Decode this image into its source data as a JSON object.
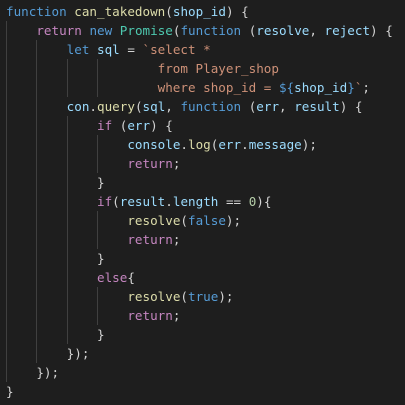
{
  "editor": {
    "colors": {
      "background": "#1e1e1e",
      "keyword": "#569cd6",
      "control": "#c586c0",
      "function": "#dcdcaa",
      "variable": "#9cdcfe",
      "string": "#ce9178",
      "class": "#4ec9b0",
      "number": "#b5cea8",
      "text": "#d4d4d4"
    },
    "lines": [
      [
        [
          "kw",
          "function"
        ],
        [
          "op",
          " "
        ],
        [
          "fn",
          "can_takedown"
        ],
        [
          "op",
          "("
        ],
        [
          "var",
          "shop_id"
        ],
        [
          "op",
          ") {"
        ]
      ],
      [
        [
          "op",
          "    "
        ],
        [
          "ctrl",
          "return"
        ],
        [
          "op",
          " "
        ],
        [
          "kw",
          "new"
        ],
        [
          "op",
          " "
        ],
        [
          "cls",
          "Promise"
        ],
        [
          "op",
          "("
        ],
        [
          "kw",
          "function"
        ],
        [
          "op",
          " ("
        ],
        [
          "var",
          "resolve"
        ],
        [
          "op",
          ", "
        ],
        [
          "var",
          "reject"
        ],
        [
          "op",
          ") {"
        ]
      ],
      [
        [
          "op",
          "        "
        ],
        [
          "kw",
          "let"
        ],
        [
          "op",
          " "
        ],
        [
          "var",
          "sql"
        ],
        [
          "op",
          " = "
        ],
        [
          "str",
          "`select *"
        ]
      ],
      [
        [
          "str",
          "                    from Player_shop"
        ]
      ],
      [
        [
          "str",
          "                    where shop_id = "
        ],
        [
          "tpl",
          "${"
        ],
        [
          "var",
          "shop_id"
        ],
        [
          "tpl",
          "}"
        ],
        [
          "str",
          "`"
        ],
        [
          "op",
          ";"
        ]
      ],
      [
        [
          "op",
          "        "
        ],
        [
          "var",
          "con"
        ],
        [
          "op",
          "."
        ],
        [
          "fn",
          "query"
        ],
        [
          "op",
          "("
        ],
        [
          "var",
          "sql"
        ],
        [
          "op",
          ", "
        ],
        [
          "kw",
          "function"
        ],
        [
          "op",
          " ("
        ],
        [
          "var",
          "err"
        ],
        [
          "op",
          ", "
        ],
        [
          "var",
          "result"
        ],
        [
          "op",
          ") {"
        ]
      ],
      [
        [
          "op",
          "            "
        ],
        [
          "ctrl",
          "if"
        ],
        [
          "op",
          " ("
        ],
        [
          "var",
          "err"
        ],
        [
          "op",
          ") {"
        ]
      ],
      [
        [
          "op",
          "                "
        ],
        [
          "var",
          "console"
        ],
        [
          "op",
          "."
        ],
        [
          "fn",
          "log"
        ],
        [
          "op",
          "("
        ],
        [
          "var",
          "err"
        ],
        [
          "op",
          "."
        ],
        [
          "var",
          "message"
        ],
        [
          "op",
          ");"
        ]
      ],
      [
        [
          "op",
          "                "
        ],
        [
          "ctrl",
          "return"
        ],
        [
          "op",
          ";"
        ]
      ],
      [
        [
          "op",
          "            }"
        ]
      ],
      [
        [
          "op",
          "            "
        ],
        [
          "ctrl",
          "if"
        ],
        [
          "op",
          "("
        ],
        [
          "var",
          "result"
        ],
        [
          "op",
          "."
        ],
        [
          "var",
          "length"
        ],
        [
          "op",
          " == "
        ],
        [
          "num",
          "0"
        ],
        [
          "op",
          "){"
        ]
      ],
      [
        [
          "op",
          "                "
        ],
        [
          "fn",
          "resolve"
        ],
        [
          "op",
          "("
        ],
        [
          "kw",
          "false"
        ],
        [
          "op",
          ");"
        ]
      ],
      [
        [
          "op",
          "                "
        ],
        [
          "ctrl",
          "return"
        ],
        [
          "op",
          ";"
        ]
      ],
      [
        [
          "op",
          "            }"
        ]
      ],
      [
        [
          "op",
          "            "
        ],
        [
          "ctrl",
          "else"
        ],
        [
          "op",
          "{"
        ]
      ],
      [
        [
          "op",
          "                "
        ],
        [
          "fn",
          "resolve"
        ],
        [
          "op",
          "("
        ],
        [
          "kw",
          "true"
        ],
        [
          "op",
          ");"
        ]
      ],
      [
        [
          "op",
          "                "
        ],
        [
          "ctrl",
          "return"
        ],
        [
          "op",
          ";"
        ]
      ],
      [
        [
          "op",
          "            }"
        ]
      ],
      [
        [
          "op",
          "        });"
        ]
      ],
      [
        [
          "op",
          "    });"
        ]
      ],
      [
        [
          "op",
          "}"
        ]
      ]
    ]
  }
}
